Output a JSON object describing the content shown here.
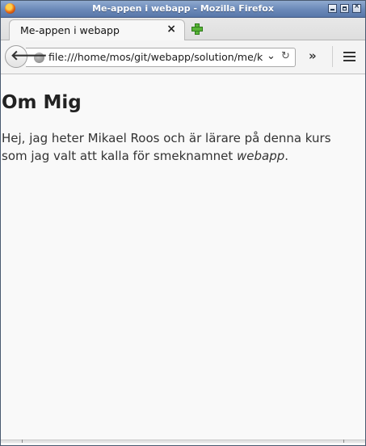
{
  "window": {
    "title": "Me-appen i webapp - Mozilla Firefox"
  },
  "tab": {
    "title": "Me-appen i webapp",
    "close_glyph": "×"
  },
  "toolbar": {
    "back_glyph": "🡐",
    "overflow_glyph": "»"
  },
  "urlbar": {
    "value": "file:///home/mos/git/webapp/solution/me/k",
    "dropdown_glyph": "⌄",
    "reload_glyph": "↻"
  },
  "page": {
    "heading": "Om Mig",
    "paragraph_before": "Hej, jag heter Mikael Roos och är lärare på denna kurs som jag valt att kalla för smeknamnet ",
    "paragraph_emphasis": "webapp",
    "paragraph_after": "."
  },
  "icons": [
    "firefox-icon",
    "minimize-icon",
    "maximize-icon",
    "close-icon",
    "new-tab-icon",
    "back-arrow-icon",
    "globe-icon",
    "dropdown-icon",
    "reload-icon",
    "overflow-icon",
    "hamburger-menu-icon"
  ],
  "colors": {
    "titlebar": "#6a88b8",
    "new_tab": "#58b437"
  }
}
